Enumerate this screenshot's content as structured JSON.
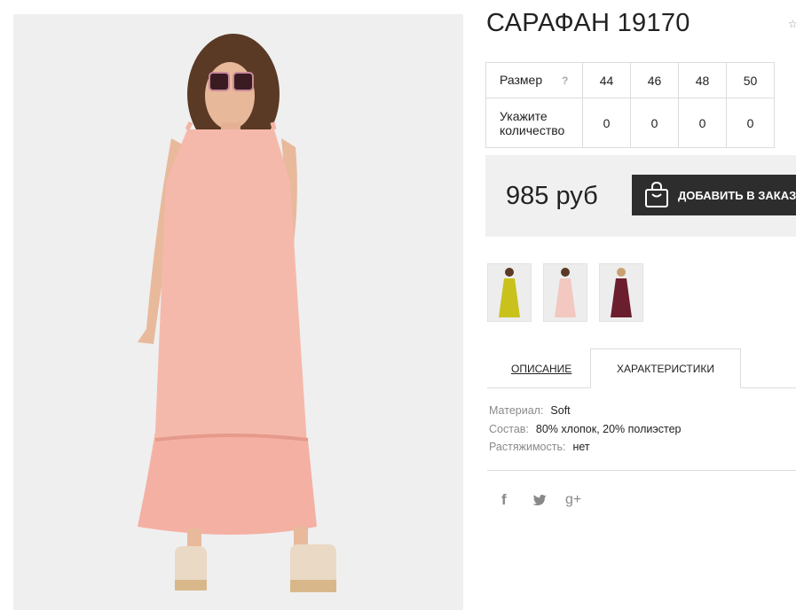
{
  "product": {
    "title": "САРАФАН 19170",
    "price": "985 руб",
    "add_to_cart_label": "ДОБАВИТЬ В ЗАКАЗ"
  },
  "size_table": {
    "size_label": "Размер",
    "help": "?",
    "sizes": [
      "44",
      "46",
      "48",
      "50"
    ],
    "qty_label_line1": "Укажите",
    "qty_label_line2": "количество",
    "quantities": [
      "0",
      "0",
      "0",
      "0"
    ]
  },
  "thumbnails": [
    {
      "color": "#c9c21c"
    },
    {
      "color": "#f2c8c0"
    },
    {
      "color": "#6b1e2e"
    }
  ],
  "tabs": {
    "description": "ОПИСАНИЕ",
    "characteristics": "ХАРАКТЕРИСТИКИ"
  },
  "specs": [
    {
      "key": "Материал:",
      "value": "Soft"
    },
    {
      "key": "Состав:",
      "value": "80% хлопок, 20% полиэстер"
    },
    {
      "key": "Растяжимость:",
      "value": "нет"
    }
  ],
  "social": {
    "facebook": "f",
    "twitter": "twitter-icon",
    "google_plus": "g+"
  },
  "colors": {
    "dress": "#f5b9ab",
    "button_bg": "#2d2d2d",
    "price_bg": "#f0f0f0"
  }
}
